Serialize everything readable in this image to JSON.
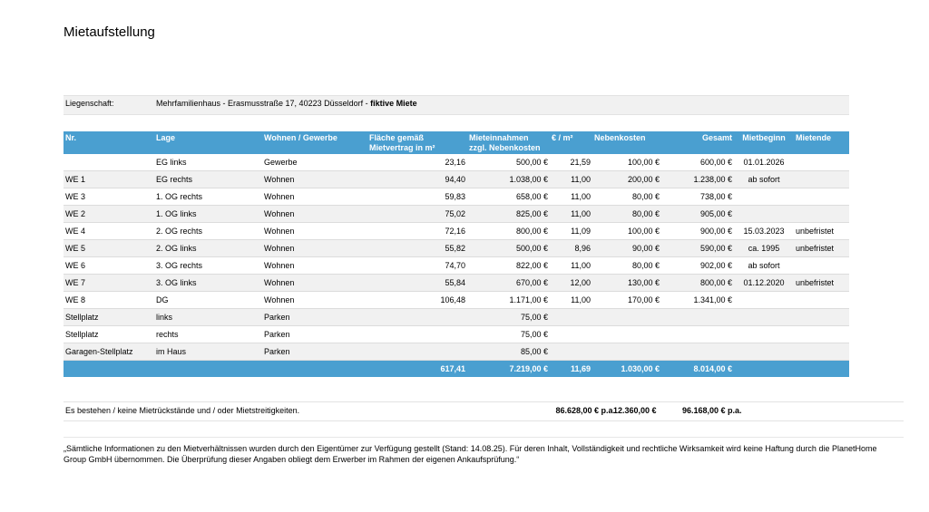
{
  "title": "Mietaufstellung",
  "property": {
    "label": "Liegenschaft:",
    "value": "Mehrfamilienhaus - Erasmusstraße 17, 40223 Düsseldorf - ",
    "bold": "fiktive Miete"
  },
  "headers": {
    "nr": "Nr.",
    "lage": "Lage",
    "art": "Wohnen / Gewerbe",
    "flaeche_1": "Fläche gemäß",
    "flaeche_2": "Mietvertrag in m²",
    "miete_1": "Mieteinnahmen",
    "miete_2": "zzgl. Nebenkosten",
    "qm": "€ / m²",
    "nebenkosten": "Nebenkosten",
    "gesamt": "Gesamt",
    "mietbeginn": "Mietbeginn",
    "mietende": "Mietende"
  },
  "rows": [
    {
      "nr": "",
      "lage": "EG links",
      "art": "Gewerbe",
      "flaeche": "23,16",
      "miete": "500,00 €",
      "qm": "21,59",
      "nk": "100,00 €",
      "gesamt": "600,00 €",
      "beginn": "01.01.2026",
      "ende": ""
    },
    {
      "nr": "WE 1",
      "lage": "EG rechts",
      "art": "Wohnen",
      "flaeche": "94,40",
      "miete": "1.038,00 €",
      "qm": "11,00",
      "nk": "200,00 €",
      "gesamt": "1.238,00 €",
      "beginn": "ab sofort",
      "ende": ""
    },
    {
      "nr": "WE 3",
      "lage": "1. OG rechts",
      "art": "Wohnen",
      "flaeche": "59,83",
      "miete": "658,00 €",
      "qm": "11,00",
      "nk": "80,00 €",
      "gesamt": "738,00 €",
      "beginn": "",
      "ende": ""
    },
    {
      "nr": "WE 2",
      "lage": "1. OG links",
      "art": "Wohnen",
      "flaeche": "75,02",
      "miete": "825,00 €",
      "qm": "11,00",
      "nk": "80,00 €",
      "gesamt": "905,00 €",
      "beginn": "",
      "ende": ""
    },
    {
      "nr": "WE 4",
      "lage": "2. OG rechts",
      "art": "Wohnen",
      "flaeche": "72,16",
      "miete": "800,00 €",
      "qm": "11,09",
      "nk": "100,00 €",
      "gesamt": "900,00 €",
      "beginn": "15.03.2023",
      "ende": "unbefristet"
    },
    {
      "nr": "WE 5",
      "lage": "2. OG links",
      "art": "Wohnen",
      "flaeche": "55,82",
      "miete": "500,00 €",
      "qm": "8,96",
      "nk": "90,00 €",
      "gesamt": "590,00 €",
      "beginn": "ca. 1995",
      "ende": "unbefristet"
    },
    {
      "nr": "WE 6",
      "lage": "3. OG rechts",
      "art": "Wohnen",
      "flaeche": "74,70",
      "miete": "822,00 €",
      "qm": "11,00",
      "nk": "80,00 €",
      "gesamt": "902,00 €",
      "beginn": "ab sofort",
      "ende": ""
    },
    {
      "nr": "WE 7",
      "lage": "3. OG links",
      "art": "Wohnen",
      "flaeche": "55,84",
      "miete": "670,00 €",
      "qm": "12,00",
      "nk": "130,00 €",
      "gesamt": "800,00 €",
      "beginn": "01.12.2020",
      "ende": "unbefristet"
    },
    {
      "nr": "WE 8",
      "lage": "DG",
      "art": "Wohnen",
      "flaeche": "106,48",
      "miete": "1.171,00 €",
      "qm": "11,00",
      "nk": "170,00 €",
      "gesamt": "1.341,00 €",
      "beginn": "",
      "ende": ""
    },
    {
      "nr": "Stellplatz",
      "lage": "links",
      "art": "Parken",
      "flaeche": "",
      "miete": "75,00 €",
      "qm": "",
      "nk": "",
      "gesamt": "",
      "beginn": "",
      "ende": ""
    },
    {
      "nr": "Stellplatz",
      "lage": "rechts",
      "art": "Parken",
      "flaeche": "",
      "miete": "75,00 €",
      "qm": "",
      "nk": "",
      "gesamt": "",
      "beginn": "",
      "ende": ""
    },
    {
      "nr": "Garagen-Stellplatz",
      "lage": "im Haus",
      "art": "Parken",
      "flaeche": "",
      "miete": "85,00 €",
      "qm": "",
      "nk": "",
      "gesamt": "",
      "beginn": "",
      "ende": ""
    }
  ],
  "totals": {
    "flaeche": "617,41",
    "miete": "7.219,00 €",
    "qm": "11,69",
    "nk": "1.030,00 €",
    "gesamt": "8.014,00 €"
  },
  "summary": {
    "text": "Es bestehen / keine Mietrückstände und / oder Mietstreitigkeiten.",
    "miete_pa": "86.628,00 € p.a.",
    "nk_pa": "12.360,00 €",
    "gesamt_pa": "96.168,00 € p.a."
  },
  "disclaimer": "„Sämtliche Informationen zu den Mietverhältnissen wurden durch den Eigentümer zur Verfügung gestellt (Stand: 14.08.25). Für deren Inhalt, Vollständigkeit und rechtliche Wirksamkeit wird keine Haftung durch die PlanetHome Group GmbH übernommen. Die Überprüfung dieser Angaben obliegt dem Erwerber im Rahmen der eigenen Ankaufsprüfung.“",
  "colors": {
    "header_blue": "#4a9fd0",
    "row_alt": "#f1f1f1"
  }
}
